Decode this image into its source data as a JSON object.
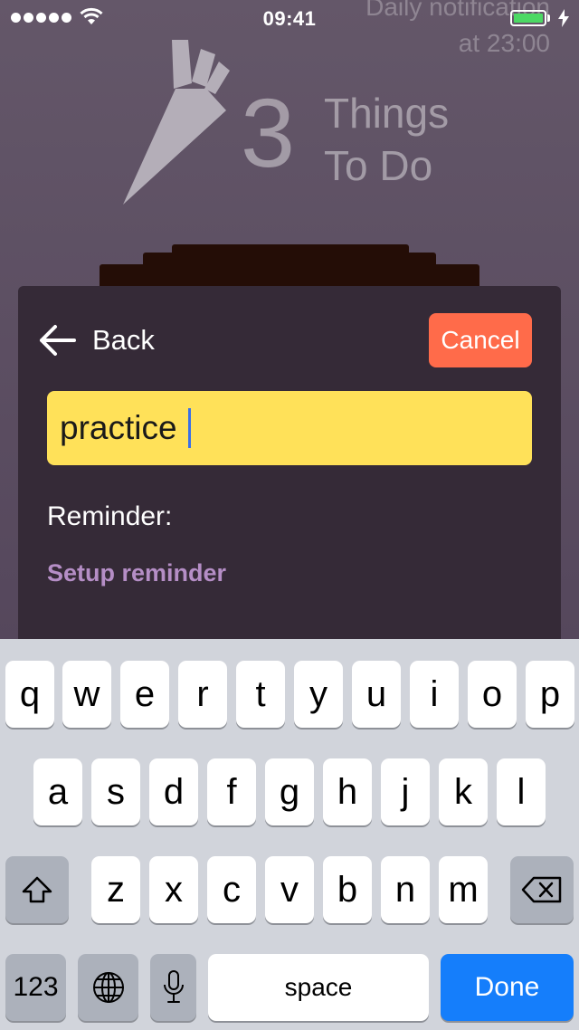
{
  "status_bar": {
    "time": "09:41",
    "signal_bars": 5,
    "wifi_icon": "wifi-icon",
    "battery_level": 1.0,
    "battery_color": "#4cd964",
    "charging_icon": "bolt-icon"
  },
  "background_notification": {
    "line1": "Daily notification",
    "line2": "at 23:00"
  },
  "logo": {
    "icon": "carrot-icon",
    "number": "3",
    "line1": "Things",
    "line2": "To Do"
  },
  "dialog": {
    "back_label": "Back",
    "cancel_label": "Cancel",
    "input_value": "practice",
    "reminder_label": "Reminder:",
    "setup_reminder_label": "Setup reminder",
    "colors": {
      "cancel": "#ff6b4a",
      "input": "#ffe159",
      "setup_link": "#b58ec6",
      "card": "#352a37"
    }
  },
  "keyboard": {
    "row1": [
      "q",
      "w",
      "e",
      "r",
      "t",
      "y",
      "u",
      "i",
      "o",
      "p"
    ],
    "row2": [
      "a",
      "s",
      "d",
      "f",
      "g",
      "h",
      "j",
      "k",
      "l"
    ],
    "row3": [
      "z",
      "x",
      "c",
      "v",
      "b",
      "n",
      "m"
    ],
    "shift_icon": "shift-icon",
    "delete_icon": "backspace-icon",
    "numbers_label": "123",
    "globe_icon": "globe-icon",
    "mic_icon": "microphone-icon",
    "space_label": "space",
    "done_label": "Done",
    "done_color": "#157efb"
  }
}
